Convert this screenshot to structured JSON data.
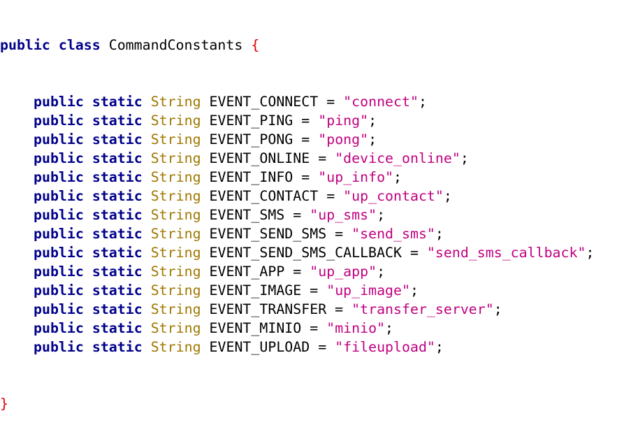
{
  "code": {
    "class_decl": {
      "modifier": "public",
      "keyword": "class",
      "name": "CommandConstants",
      "open_brace": "{"
    },
    "fields": [
      {
        "mod1": "public",
        "mod2": "static",
        "type": "String",
        "name": "EVENT_CONNECT",
        "eq": "=",
        "value": "\"connect\"",
        "semi": ";"
      },
      {
        "mod1": "public",
        "mod2": "static",
        "type": "String",
        "name": "EVENT_PING",
        "eq": "=",
        "value": "\"ping\"",
        "semi": ";"
      },
      {
        "mod1": "public",
        "mod2": "static",
        "type": "String",
        "name": "EVENT_PONG",
        "eq": "=",
        "value": "\"pong\"",
        "semi": ";"
      },
      {
        "mod1": "public",
        "mod2": "static",
        "type": "String",
        "name": "EVENT_ONLINE",
        "eq": "=",
        "value": "\"device_online\"",
        "semi": ";"
      },
      {
        "mod1": "public",
        "mod2": "static",
        "type": "String",
        "name": "EVENT_INFO",
        "eq": "=",
        "value": "\"up_info\"",
        "semi": ";"
      },
      {
        "mod1": "public",
        "mod2": "static",
        "type": "String",
        "name": "EVENT_CONTACT",
        "eq": "=",
        "value": "\"up_contact\"",
        "semi": ";"
      },
      {
        "mod1": "public",
        "mod2": "static",
        "type": "String",
        "name": "EVENT_SMS",
        "eq": "=",
        "value": "\"up_sms\"",
        "semi": ";"
      },
      {
        "mod1": "public",
        "mod2": "static",
        "type": "String",
        "name": "EVENT_SEND_SMS",
        "eq": "=",
        "value": "\"send_sms\"",
        "semi": ";"
      },
      {
        "mod1": "public",
        "mod2": "static",
        "type": "String",
        "name": "EVENT_SEND_SMS_CALLBACK",
        "eq": "=",
        "value": "\"send_sms_callback\"",
        "semi": ";"
      },
      {
        "mod1": "public",
        "mod2": "static",
        "type": "String",
        "name": "EVENT_APP",
        "eq": "=",
        "value": "\"up_app\"",
        "semi": ";"
      },
      {
        "mod1": "public",
        "mod2": "static",
        "type": "String",
        "name": "EVENT_IMAGE",
        "eq": "=",
        "value": "\"up_image\"",
        "semi": ";"
      },
      {
        "mod1": "public",
        "mod2": "static",
        "type": "String",
        "name": "EVENT_TRANSFER",
        "eq": "=",
        "value": "\"transfer_server\"",
        "semi": ";"
      },
      {
        "mod1": "public",
        "mod2": "static",
        "type": "String",
        "name": "EVENT_MINIO",
        "eq": "=",
        "value": "\"minio\"",
        "semi": ";"
      },
      {
        "mod1": "public",
        "mod2": "static",
        "type": "String",
        "name": "EVENT_UPLOAD",
        "eq": "=",
        "value": "\"fileupload\"",
        "semi": ";"
      }
    ],
    "close_brace": "}"
  },
  "colors": {
    "keyword": "#00008b",
    "type": "#a07800",
    "string": "#c00080",
    "brace": "#e00000",
    "identifier": "#000000",
    "background": "#ffffff"
  }
}
